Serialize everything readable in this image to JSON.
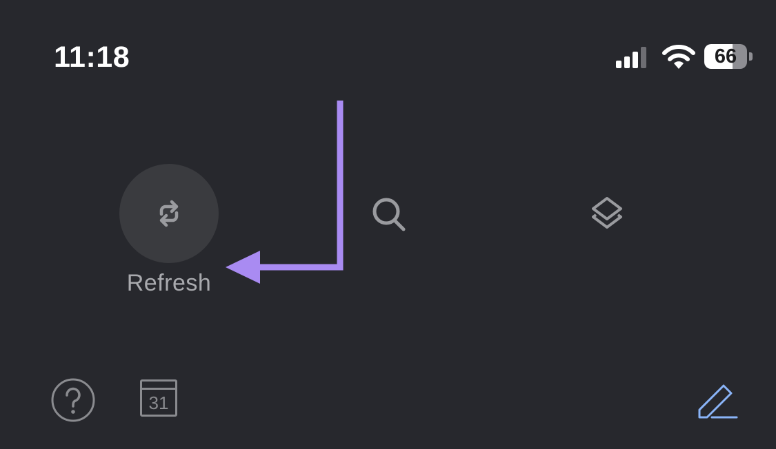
{
  "status_bar": {
    "time": "11:18",
    "battery_level": "66",
    "signal_icon": "cellular-signal-icon",
    "wifi_icon": "wifi-icon",
    "battery_icon": "battery-icon"
  },
  "actions": {
    "refresh": {
      "label": "Refresh",
      "icon": "refresh-icon"
    },
    "search": {
      "icon": "search-icon"
    },
    "layers": {
      "icon": "layers-icon"
    }
  },
  "bottom_bar": {
    "help_icon": "help-icon",
    "calendar": {
      "icon": "calendar-icon",
      "day": "31"
    },
    "compose_icon": "compose-pencil-icon"
  },
  "annotation": {
    "icon": "arrow-icon"
  },
  "colors": {
    "background": "#27282d",
    "icon_gray": "#8a8b8f",
    "label_gray": "#a9aaae",
    "circle_bg": "#3a3b3f",
    "annotation_purple": "#a98bf2",
    "compose_blue": "#8ab4f8"
  }
}
